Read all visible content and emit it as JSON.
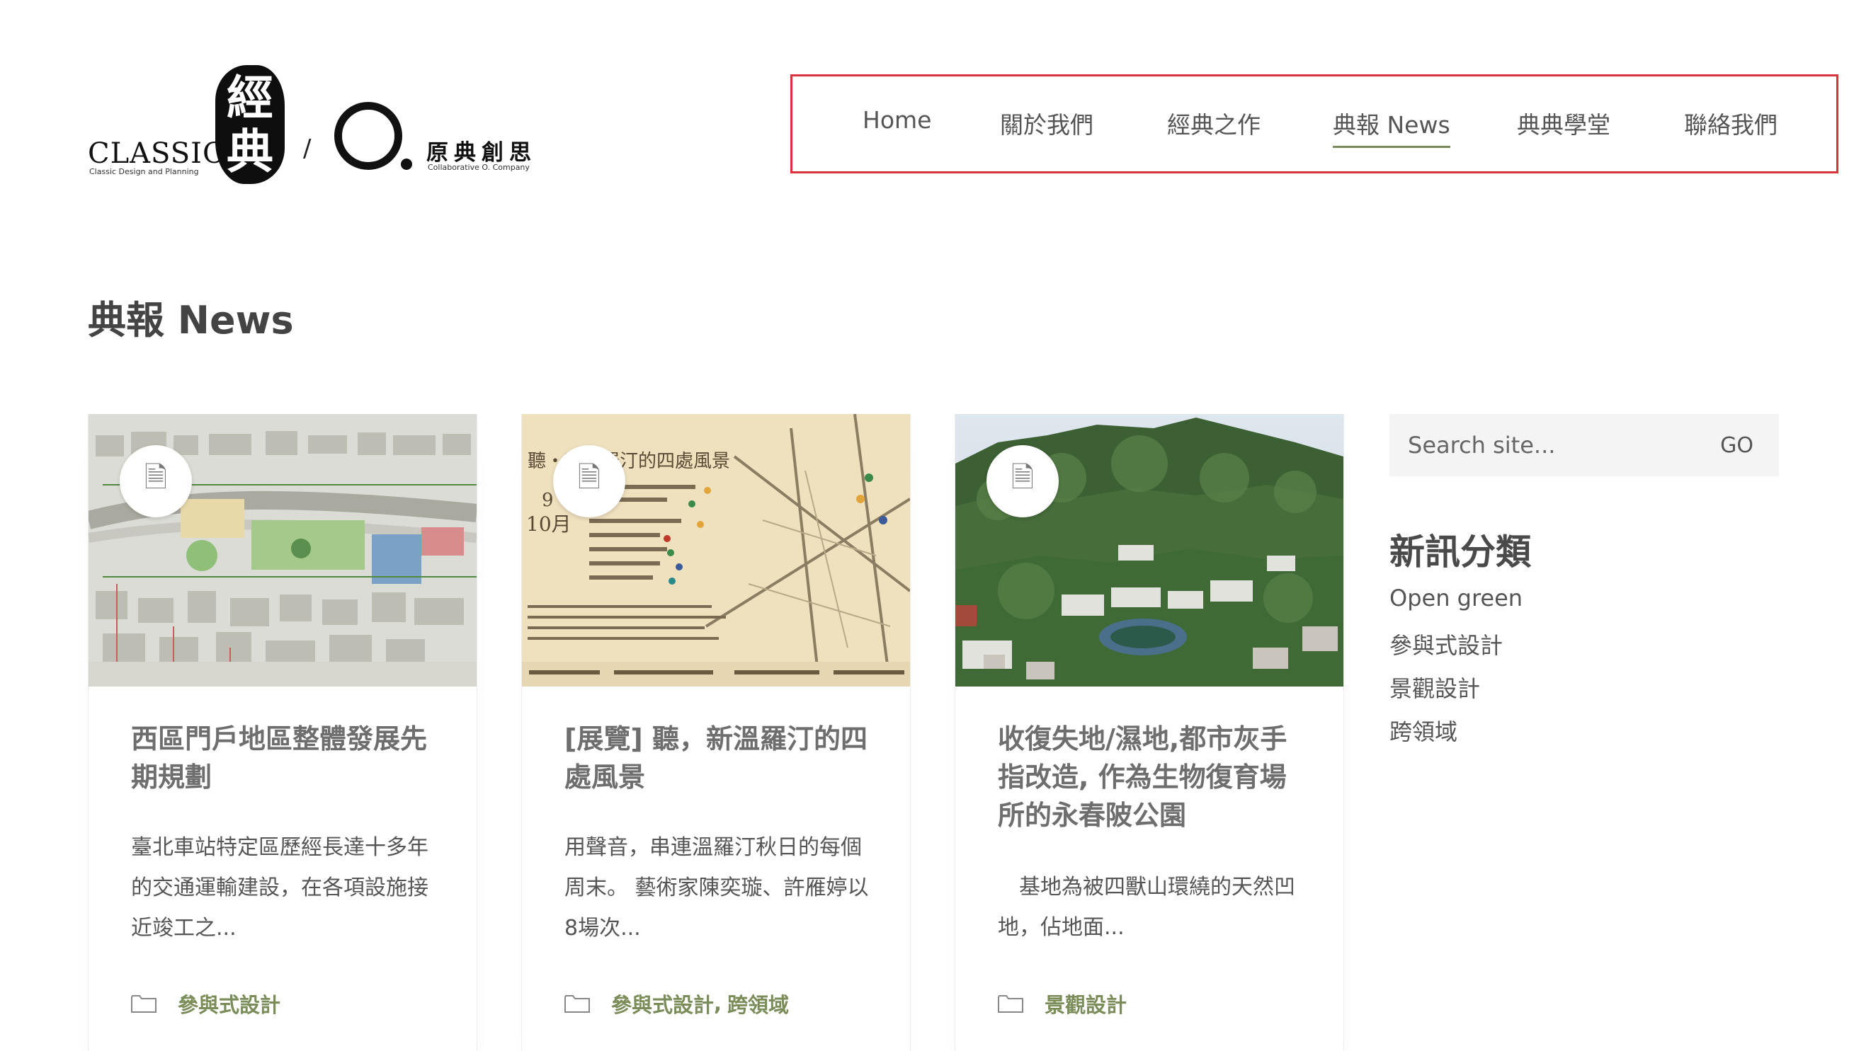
{
  "logo": {
    "classic": "CLASSIC",
    "classic_sub": "Classic Design and Planning",
    "seal_top": "經",
    "seal_bottom": "典",
    "slash": "/",
    "yuan": "原典創思",
    "yuan_sub": "Collaborative  O.  Company"
  },
  "nav": {
    "items": [
      {
        "label": "Home"
      },
      {
        "label": "關於我們"
      },
      {
        "label": "經典之作"
      },
      {
        "label": "典報 News",
        "active": true
      },
      {
        "label": "典典學堂"
      },
      {
        "label": "聯絡我們"
      }
    ]
  },
  "page": {
    "title": "典報 News"
  },
  "posts": [
    {
      "title": "西區門戶地區整體發展先期規劃",
      "excerpt": "臺北車站特定區歷經長達十多年的交通運輸建設，在各項設施接近竣工之...",
      "categories": [
        "參與式設計"
      ]
    },
    {
      "title": "[展覽] 聽，新溫羅汀的四處風景",
      "excerpt": "用聲音，串連溫羅汀秋日的每個周末。 藝術家陳奕璇、許雁婷以8場次...",
      "categories": [
        "參與式設計",
        "跨領域"
      ]
    },
    {
      "title": "收復失地/濕地,都市灰手指改造, 作為生物復育場所的永春陂公園",
      "excerpt": "　基地為被四獸山環繞的天然凹地，佔地面...",
      "categories": [
        "景觀設計"
      ]
    }
  ],
  "thumb2": {
    "heading": "聽・新溫羅汀的四處風景",
    "month_sep": "9",
    "month_oct": "10月"
  },
  "sidebar": {
    "search_placeholder": "Search site...",
    "search_button": "GO",
    "categories_title": "新訊分類",
    "categories": [
      "Open green",
      "參與式設計",
      "景觀設計",
      "跨領域"
    ]
  },
  "colors": {
    "accent": "#7a8c58",
    "nav_highlight_border": "#d9343b"
  },
  "icons": {
    "post_format": "document-icon",
    "category": "folder-icon"
  }
}
